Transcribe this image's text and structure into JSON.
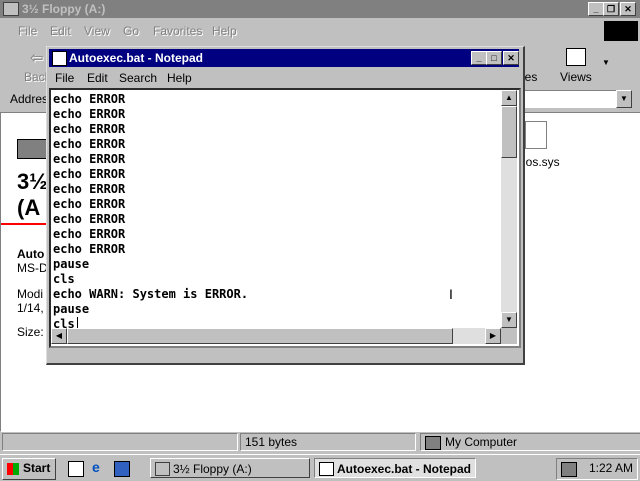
{
  "explorer": {
    "title": "3½ Floppy (A:)",
    "menu": [
      "File",
      "Edit",
      "View",
      "Go",
      "Favorites",
      "Help"
    ],
    "toolbar": {
      "back_label": "Back",
      "properties_partial": "ies",
      "views_label": "Views"
    },
    "address_label": "Address",
    "left_panel": {
      "heading_line1": "3½",
      "heading_line2": "(A",
      "file_name_partial": "Auto",
      "file_type_partial": "MS-D",
      "modified_label_partial": "Modi",
      "modified_date_partial": "1/14,",
      "size_label_partial": "Size:"
    },
    "files": [
      {
        "name": "dos.sys"
      }
    ],
    "status": {
      "size": "151 bytes",
      "zone": "My Computer"
    }
  },
  "notepad": {
    "title": "Autoexec.bat - Notepad",
    "menu": [
      "File",
      "Edit",
      "Search",
      "Help"
    ],
    "content": "echo ERROR\necho ERROR\necho ERROR\necho ERROR\necho ERROR\necho ERROR\necho ERROR\necho ERROR\necho ERROR\necho ERROR\necho ERROR\npause\ncls\necho WARN: System is ERROR.\npause\ncls"
  },
  "taskbar": {
    "start_label": "Start",
    "tasks": [
      {
        "label": "3½ Floppy (A:)"
      },
      {
        "label": "Autoexec.bat - Notepad"
      }
    ],
    "clock": "1:22 AM"
  },
  "colors": {
    "active_title": "#000080",
    "inactive_title": "#808080",
    "face": "#c0c0c0",
    "red_rule": "#ff0000"
  }
}
